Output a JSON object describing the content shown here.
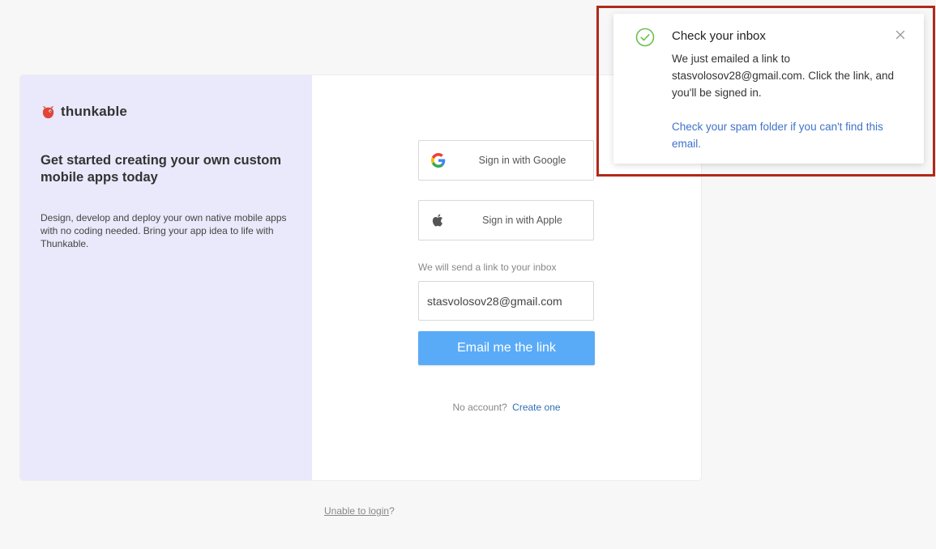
{
  "brand": {
    "name": "thunkable",
    "logo_color": "#e0453a"
  },
  "left_panel": {
    "headline": "Get started creating your own custom mobile apps today",
    "description": "Design, develop and deploy your own native mobile apps with no coding needed. Bring your app idea to life with Thunkable."
  },
  "signin": {
    "google_label": "Sign in with Google",
    "apple_label": "Sign in with Apple",
    "email_hint": "We will send a link to your inbox",
    "email_value": "stasvolosov28@gmail.com",
    "email_button_label": "Email me the link",
    "no_account_text": "No account?",
    "create_link": "Create one"
  },
  "footer": {
    "unable_link": "Unable to login",
    "unable_suffix": "?"
  },
  "toast": {
    "title": "Check your inbox",
    "body": "We just emailed a link to stasvolosov28@gmail.com. Click the link, and you'll be signed in.",
    "spam_link": "Check your spam folder if you can't find this email.",
    "check_color": "#6bbf4e",
    "close_icon": "close-icon"
  },
  "colors": {
    "accent": "#5aabf7",
    "panel": "#e9e9fb",
    "link": "#2f6fb5",
    "highlight": "#b02a1a"
  }
}
